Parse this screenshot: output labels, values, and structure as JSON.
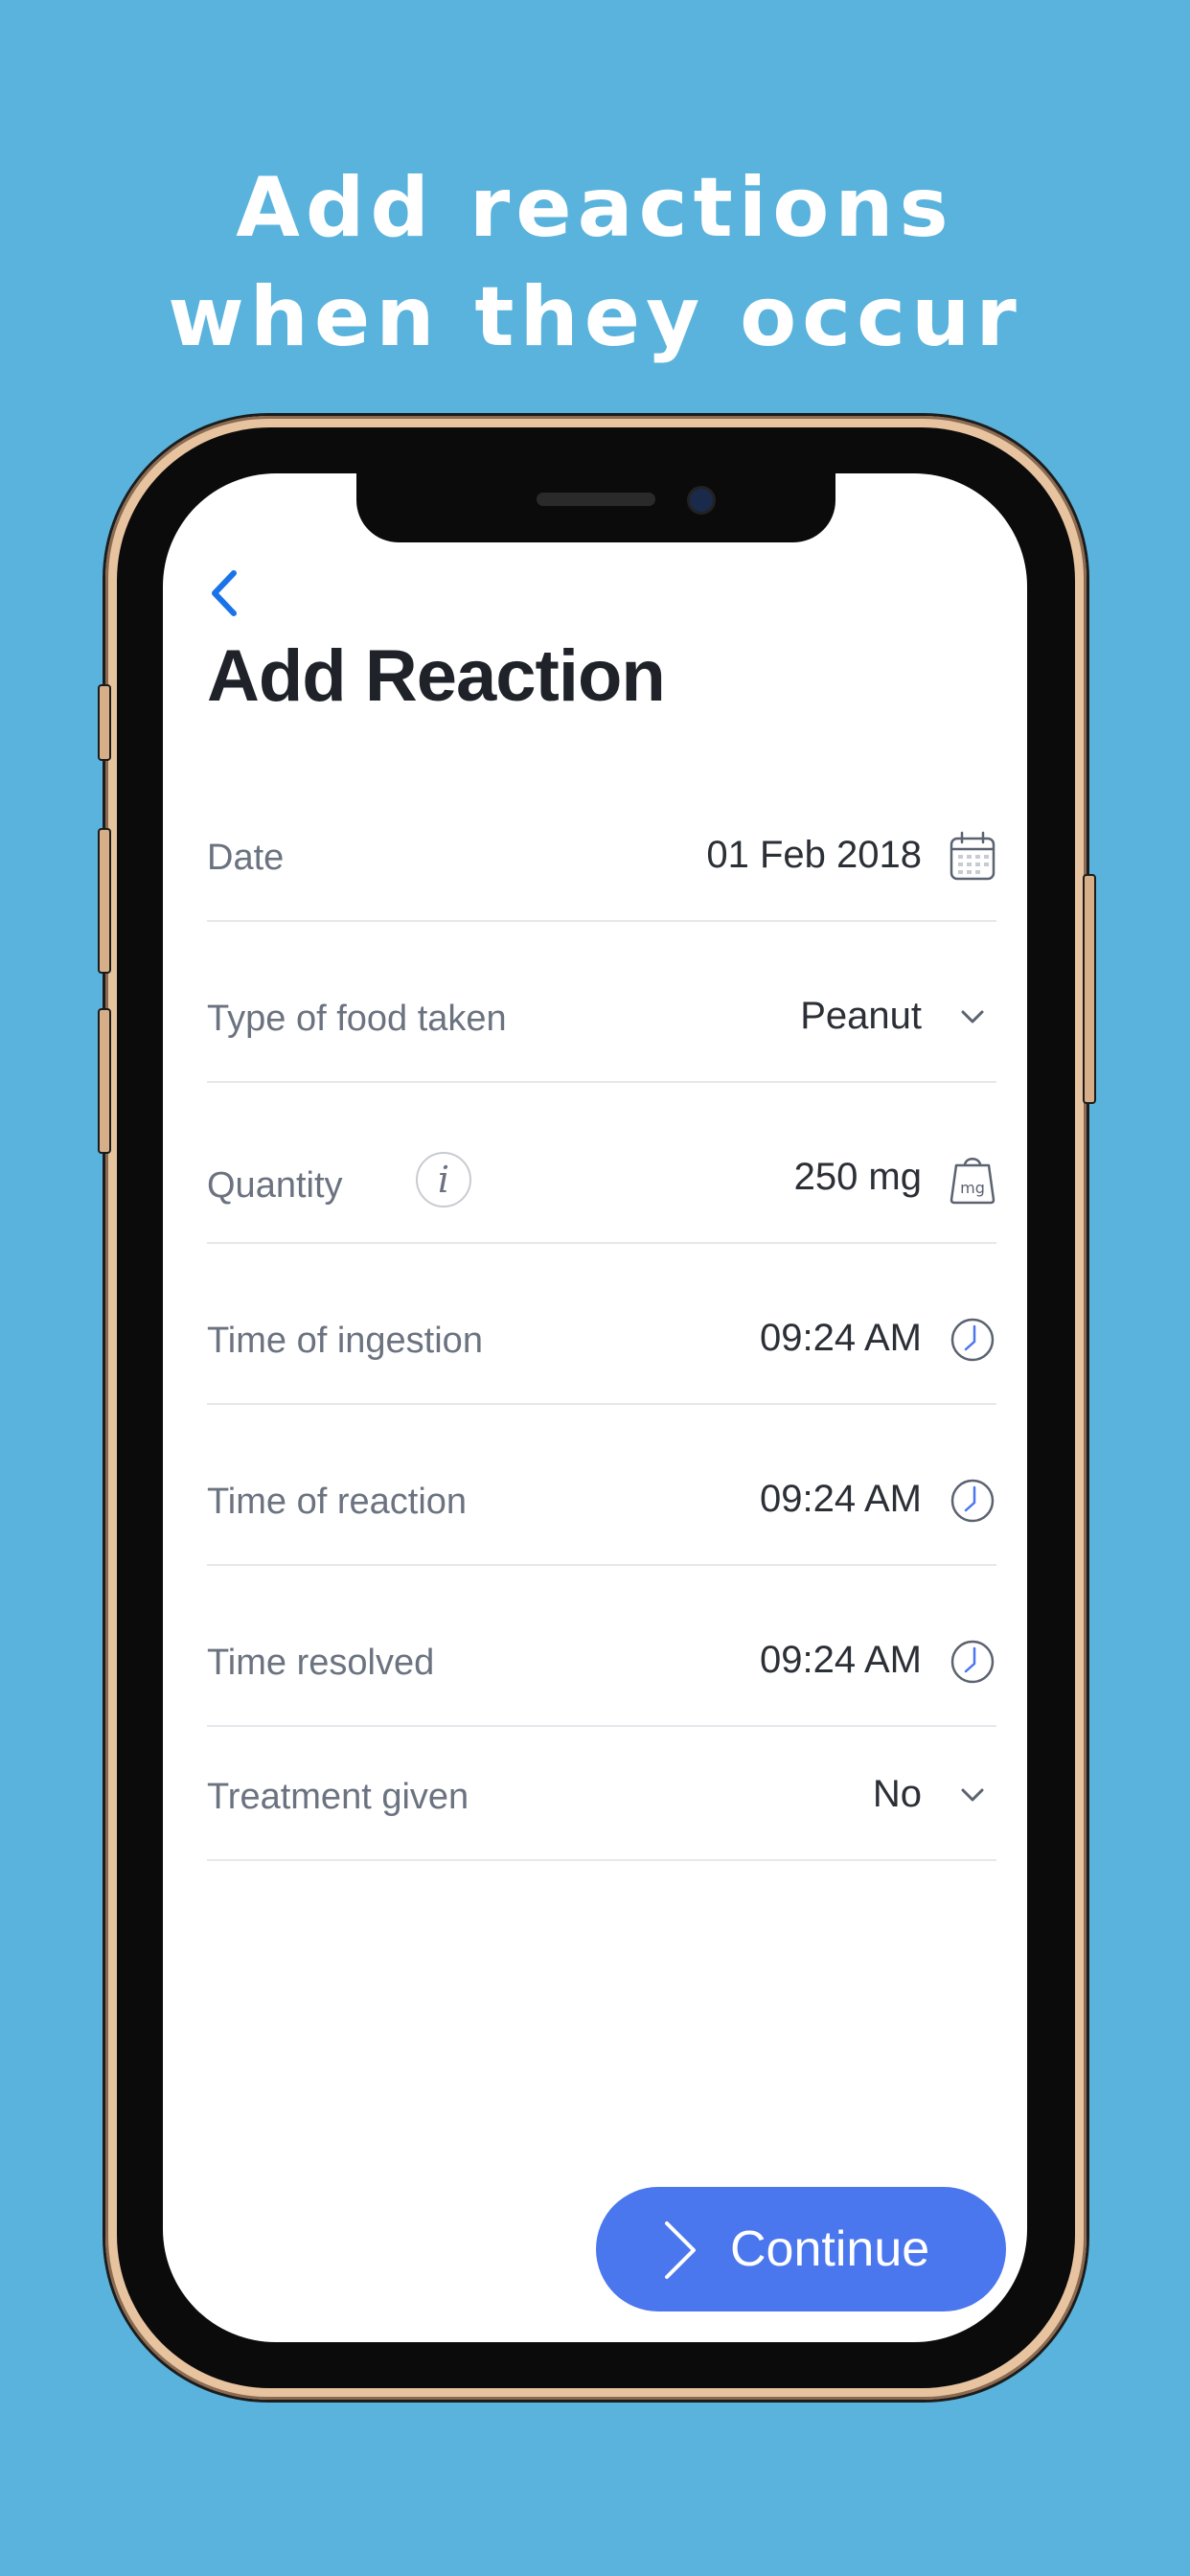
{
  "headline": {
    "line1": "Add reactions",
    "line2": "when they occur"
  },
  "screen": {
    "title": "Add Reaction",
    "fields": [
      {
        "label": "Date",
        "value": "01 Feb 2018",
        "icon": "calendar-icon"
      },
      {
        "label": "Type of food taken",
        "value": "Peanut",
        "icon": "chevron-down-icon"
      },
      {
        "label": "Quantity",
        "value": "250 mg",
        "icon": "weight-icon",
        "icon_text": "mg",
        "info": "i"
      },
      {
        "label": "Time of ingestion",
        "value": "09:24 AM",
        "icon": "clock-icon"
      },
      {
        "label": "Time of reaction",
        "value": "09:24 AM",
        "icon": "clock-icon"
      },
      {
        "label": "Time resolved",
        "value": "09:24 AM",
        "icon": "clock-icon"
      },
      {
        "label": "Treatment given",
        "value": "No",
        "icon": "chevron-down-icon"
      }
    ],
    "continue_label": "Continue"
  },
  "colors": {
    "background": "#5ab3dc",
    "accent": "#4b77ee",
    "back_arrow": "#1a73e8",
    "label": "#6b7280",
    "value": "#2b2f36"
  }
}
